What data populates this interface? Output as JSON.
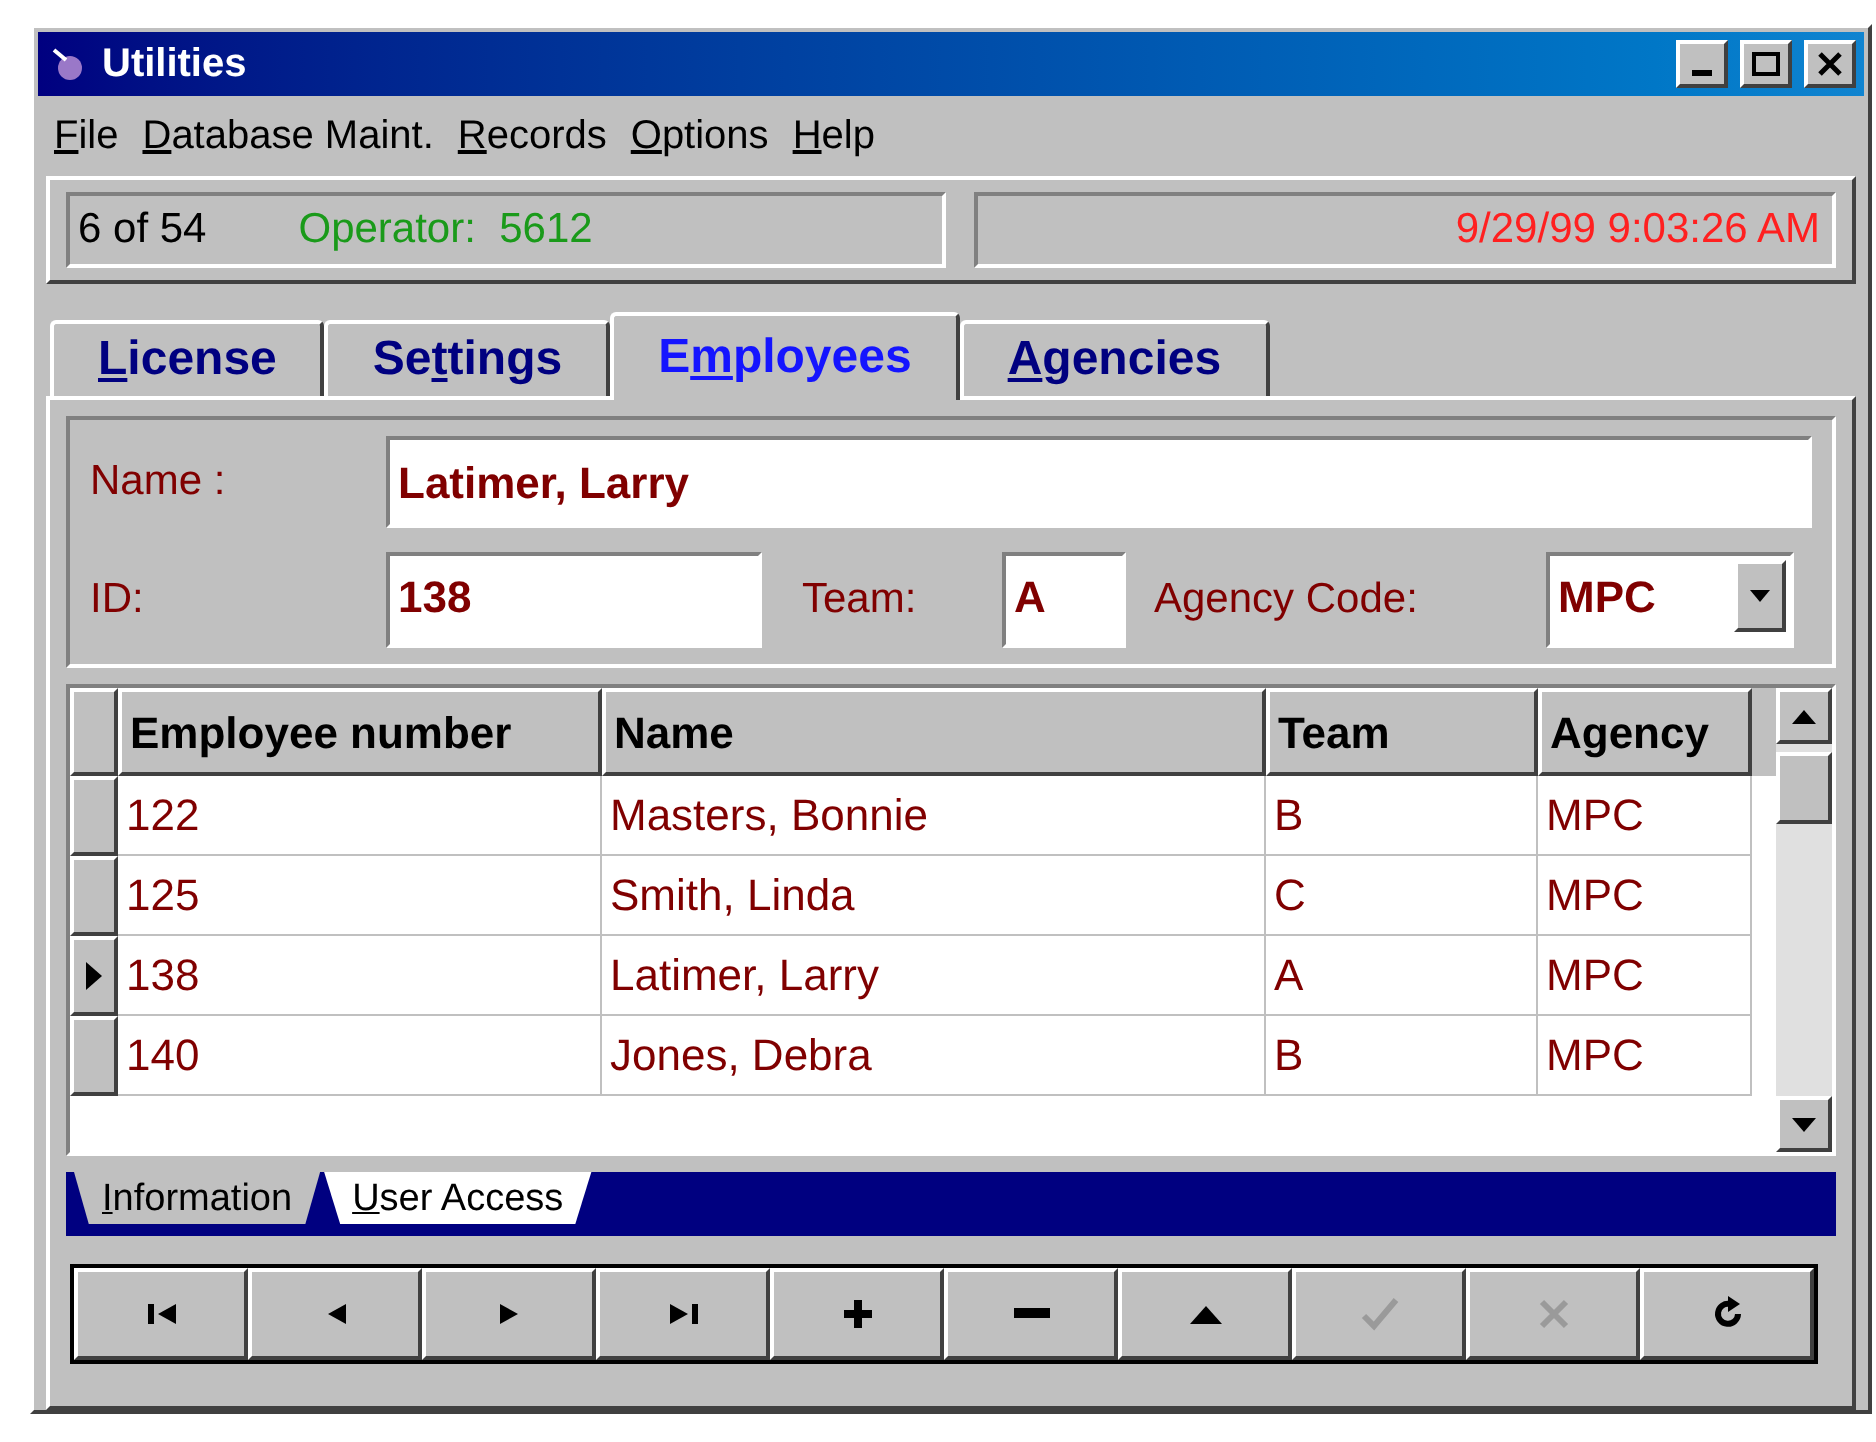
{
  "window": {
    "title": "Utilities"
  },
  "menu": [
    {
      "label": {
        "key": "F",
        "post": "ile"
      }
    },
    {
      "label": {
        "key": "D",
        "post": "atabase Maint."
      }
    },
    {
      "label": {
        "key": "R",
        "post": "ecords"
      }
    },
    {
      "label": {
        "key": "O",
        "post": "ptions"
      }
    },
    {
      "label": {
        "key": "H",
        "post": "elp"
      }
    }
  ],
  "status": {
    "record": "6 of 54",
    "operator": "Operator:  5612",
    "datetime": "9/29/99 9:03:26 AM"
  },
  "tabs": [
    {
      "label": {
        "key": "L",
        "post": "icense"
      },
      "selected": false
    },
    {
      "label": {
        "pre": "Se",
        "key": "t",
        "post": "tings"
      },
      "selected": false
    },
    {
      "label": {
        "pre": "E",
        "key": "m",
        "post": "ployees"
      },
      "selected": true
    },
    {
      "label": {
        "key": "A",
        "post": "gencies"
      },
      "selected": false
    }
  ],
  "form": {
    "name_label": "Name :",
    "name": "Latimer, Larry",
    "id_label": "ID:",
    "id": "138",
    "team_label": "Team:",
    "team": "A",
    "agency_label": "Agency Code:",
    "agency": "MPC"
  },
  "table": {
    "columns": [
      "Employee number",
      "Name",
      "Team",
      "Agency"
    ],
    "rows": [
      {
        "cells": [
          "122",
          "Masters, Bonnie",
          "B",
          "MPC"
        ],
        "selected": false
      },
      {
        "cells": [
          "125",
          "Smith, Linda",
          "C",
          "MPC"
        ],
        "selected": false
      },
      {
        "cells": [
          "138",
          "Latimer, Larry",
          "A",
          "MPC"
        ],
        "selected": true
      },
      {
        "cells": [
          "140",
          "Jones, Debra",
          "B",
          "MPC"
        ],
        "selected": false
      }
    ]
  },
  "bottom_tabs": [
    {
      "label": {
        "key": "I",
        "post": "nformation"
      },
      "selected": false
    },
    {
      "label": {
        "key": "U",
        "post": "ser Access"
      },
      "selected": true
    }
  ],
  "toolbar": [
    {
      "kind": "first",
      "disabled": false
    },
    {
      "kind": "prior",
      "disabled": false
    },
    {
      "kind": "next",
      "disabled": false
    },
    {
      "kind": "last",
      "disabled": false
    },
    {
      "kind": "insert",
      "disabled": false
    },
    {
      "kind": "delete",
      "disabled": false
    },
    {
      "kind": "edit",
      "disabled": false
    },
    {
      "kind": "post",
      "disabled": true
    },
    {
      "kind": "cancel",
      "disabled": true
    },
    {
      "kind": "refresh",
      "disabled": false
    }
  ]
}
